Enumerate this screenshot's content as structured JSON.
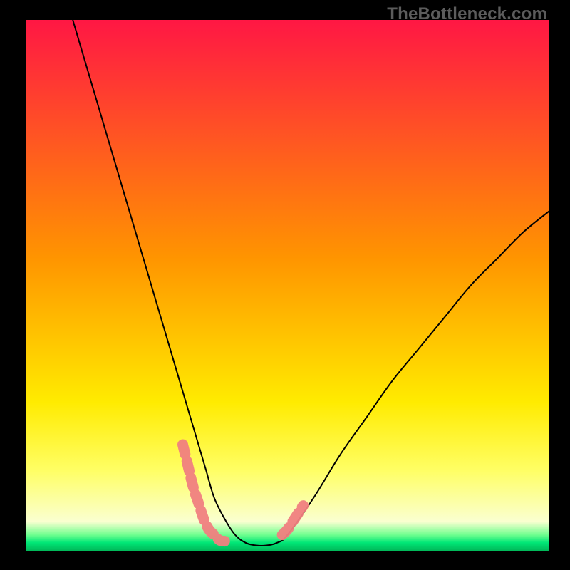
{
  "watermark": "TheBottleneck.com",
  "chart_data": {
    "type": "line",
    "title": "",
    "xlabel": "",
    "ylabel": "",
    "xlim": [
      0,
      100
    ],
    "ylim": [
      0,
      100
    ],
    "background_gradient": {
      "stops": [
        {
          "offset": 0,
          "color": "#ff1744"
        },
        {
          "offset": 0.45,
          "color": "#ff9500"
        },
        {
          "offset": 0.72,
          "color": "#ffeb00"
        },
        {
          "offset": 0.85,
          "color": "#ffff66"
        },
        {
          "offset": 0.945,
          "color": "#faffd0"
        },
        {
          "offset": 0.97,
          "color": "#6fff8f"
        },
        {
          "offset": 0.985,
          "color": "#00e676"
        },
        {
          "offset": 1,
          "color": "#00b858"
        }
      ]
    },
    "series": [
      {
        "name": "bottleneck-curve",
        "color": "#000000",
        "x": [
          9,
          12,
          15,
          18,
          21,
          24,
          27,
          30,
          31.5,
          33,
          34.5,
          36,
          38,
          40,
          42,
          44,
          46,
          48,
          50,
          55,
          60,
          65,
          70,
          75,
          80,
          85,
          90,
          95,
          100
        ],
        "y": [
          100,
          90,
          80,
          70,
          60,
          50,
          40,
          30,
          25,
          20,
          15,
          10,
          6,
          3,
          1.5,
          1,
          1,
          1.5,
          3,
          10,
          18,
          25,
          32,
          38,
          44,
          50,
          55,
          60,
          64
        ]
      },
      {
        "name": "highlight-band",
        "color": "#f08080",
        "type": "marker-band",
        "segments": [
          {
            "x": [
              30,
              31,
              32,
              33,
              34,
              35,
              36,
              37,
              38
            ],
            "y": [
              20,
              16,
              12,
              9,
              6,
              4,
              3,
              2,
              1.8
            ]
          },
          {
            "x": [
              49,
              50,
              51,
              52,
              53
            ],
            "y": [
              3,
              4,
              5.5,
              7,
              8.5
            ]
          }
        ]
      }
    ]
  }
}
